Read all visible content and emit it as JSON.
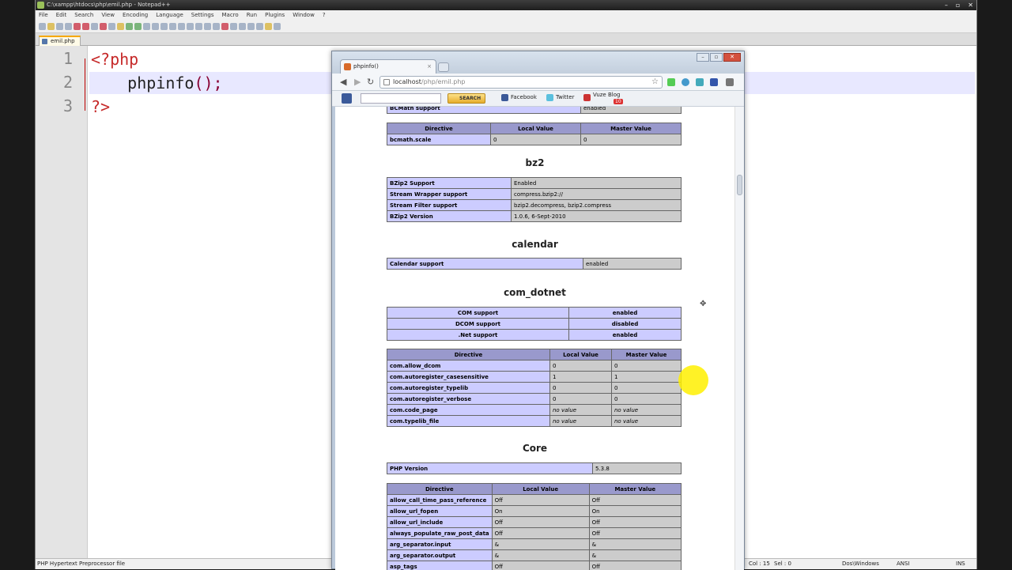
{
  "notepad": {
    "title": "C:\\xampp\\htdocs\\php\\emil.php - Notepad++",
    "menu": [
      "File",
      "Edit",
      "Search",
      "View",
      "Encoding",
      "Language",
      "Settings",
      "Macro",
      "Run",
      "Plugins",
      "Window",
      "?"
    ],
    "tab": "emil.php",
    "line_numbers": [
      "1",
      "2",
      "3"
    ],
    "code": {
      "line1": "<?php",
      "line2_indent": "    ",
      "line2_fn": "phpinfo",
      "line2_paren": "();",
      "line3": "?>"
    },
    "status": {
      "filetype": "PHP Hypertext Preprocessor file",
      "col": "Col : 15",
      "sel": "Sel : 0",
      "eol": "Dos\\Windows",
      "enc": "ANSI",
      "mode": "INS"
    }
  },
  "browser": {
    "tab_title": "phpinfo()",
    "url_host": "localhost",
    "url_path": "/php/emil.php",
    "search_label": "SEARCH",
    "toolbar_links": [
      "Facebook",
      "Twitter",
      "Vuze Blog"
    ],
    "badge": "10"
  },
  "phpinfo": {
    "bcmath": {
      "support_label": "BCMath support",
      "support_value": "enabled",
      "headers": [
        "Directive",
        "Local Value",
        "Master Value"
      ],
      "rows": [
        [
          "bcmath.scale",
          "0",
          "0"
        ]
      ]
    },
    "bz2": {
      "title": "bz2",
      "rows": [
        [
          "BZip2 Support",
          "Enabled"
        ],
        [
          "Stream Wrapper support",
          "compress.bzip2://"
        ],
        [
          "Stream Filter support",
          "bzip2.decompress, bzip2.compress"
        ],
        [
          "BZip2 Version",
          "1.0.6, 6-Sept-2010"
        ]
      ]
    },
    "calendar": {
      "title": "calendar",
      "rows": [
        [
          "Calendar support",
          "enabled"
        ]
      ]
    },
    "com_dotnet": {
      "title": "com_dotnet",
      "support_rows": [
        [
          "COM support",
          "enabled"
        ],
        [
          "DCOM support",
          "disabled"
        ],
        [
          ".Net support",
          "enabled"
        ]
      ],
      "headers": [
        "Directive",
        "Local Value",
        "Master Value"
      ],
      "rows": [
        [
          "com.allow_dcom",
          "0",
          "0"
        ],
        [
          "com.autoregister_casesensitive",
          "1",
          "1"
        ],
        [
          "com.autoregister_typelib",
          "0",
          "0"
        ],
        [
          "com.autoregister_verbose",
          "0",
          "0"
        ],
        [
          "com.code_page",
          "no value",
          "no value"
        ],
        [
          "com.typelib_file",
          "no value",
          "no value"
        ]
      ]
    },
    "core": {
      "title": "Core",
      "version_label": "PHP Version",
      "version_value": "5.3.8",
      "headers": [
        "Directive",
        "Local Value",
        "Master Value"
      ],
      "rows": [
        [
          "allow_call_time_pass_reference",
          "Off",
          "Off"
        ],
        [
          "allow_url_fopen",
          "On",
          "On"
        ],
        [
          "allow_url_include",
          "Off",
          "Off"
        ],
        [
          "always_populate_raw_post_data",
          "Off",
          "Off"
        ],
        [
          "arg_separator.input",
          "&",
          "&"
        ],
        [
          "arg_separator.output",
          "&",
          "&"
        ],
        [
          "asp_tags",
          "Off",
          "Off"
        ]
      ]
    }
  }
}
